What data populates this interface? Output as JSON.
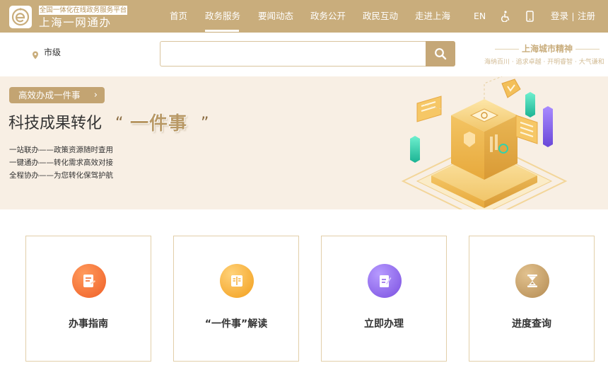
{
  "header": {
    "logo_tagline": "全国一体化在线政务服务平台",
    "logo_name": "上海一网通办",
    "nav": [
      {
        "label": "首页",
        "active": false
      },
      {
        "label": "政务服务",
        "active": true
      },
      {
        "label": "要闻动态",
        "active": false
      },
      {
        "label": "政务公开",
        "active": false
      },
      {
        "label": "政民互动",
        "active": false
      },
      {
        "label": "走进上海",
        "active": false
      }
    ],
    "lang_label": "EN",
    "login_label": "登录",
    "register_label": "注册",
    "icons": [
      "accessibility-icon",
      "mobile-icon"
    ]
  },
  "search": {
    "location": "市级",
    "placeholder": "",
    "icon": "search-icon"
  },
  "city_spirit": {
    "title": "上海城市精神",
    "subtitle": "海纳百川 · 追求卓越 · 开明睿智 · 大气谦和"
  },
  "banner": {
    "pill_label": "高效办成一件事",
    "pill_arrow": "›",
    "title": "科技成果转化",
    "quote_open": "“",
    "highlight": "一件事",
    "quote_close": "”",
    "features": [
      "一站联办——政策资源随时查用",
      "一键通办——转化需求高效对接",
      "全程协办——为您转化保驾护航"
    ]
  },
  "cards": [
    {
      "label": "办事指南",
      "icon": "guide-icon",
      "color": "#f26a2e"
    },
    {
      "label": "“一件事”解读",
      "icon": "book-icon",
      "color": "#f5a623"
    },
    {
      "label": "立即办理",
      "icon": "form-edit-icon",
      "color": "#8c5ce6"
    },
    {
      "label": "进度查询",
      "icon": "hourglass-icon",
      "color": "#c09a63"
    }
  ],
  "colors": {
    "brand_gold": "#c9ad7c",
    "banner_bg": "#f8efe4",
    "card_border": "#e2cfa9"
  }
}
